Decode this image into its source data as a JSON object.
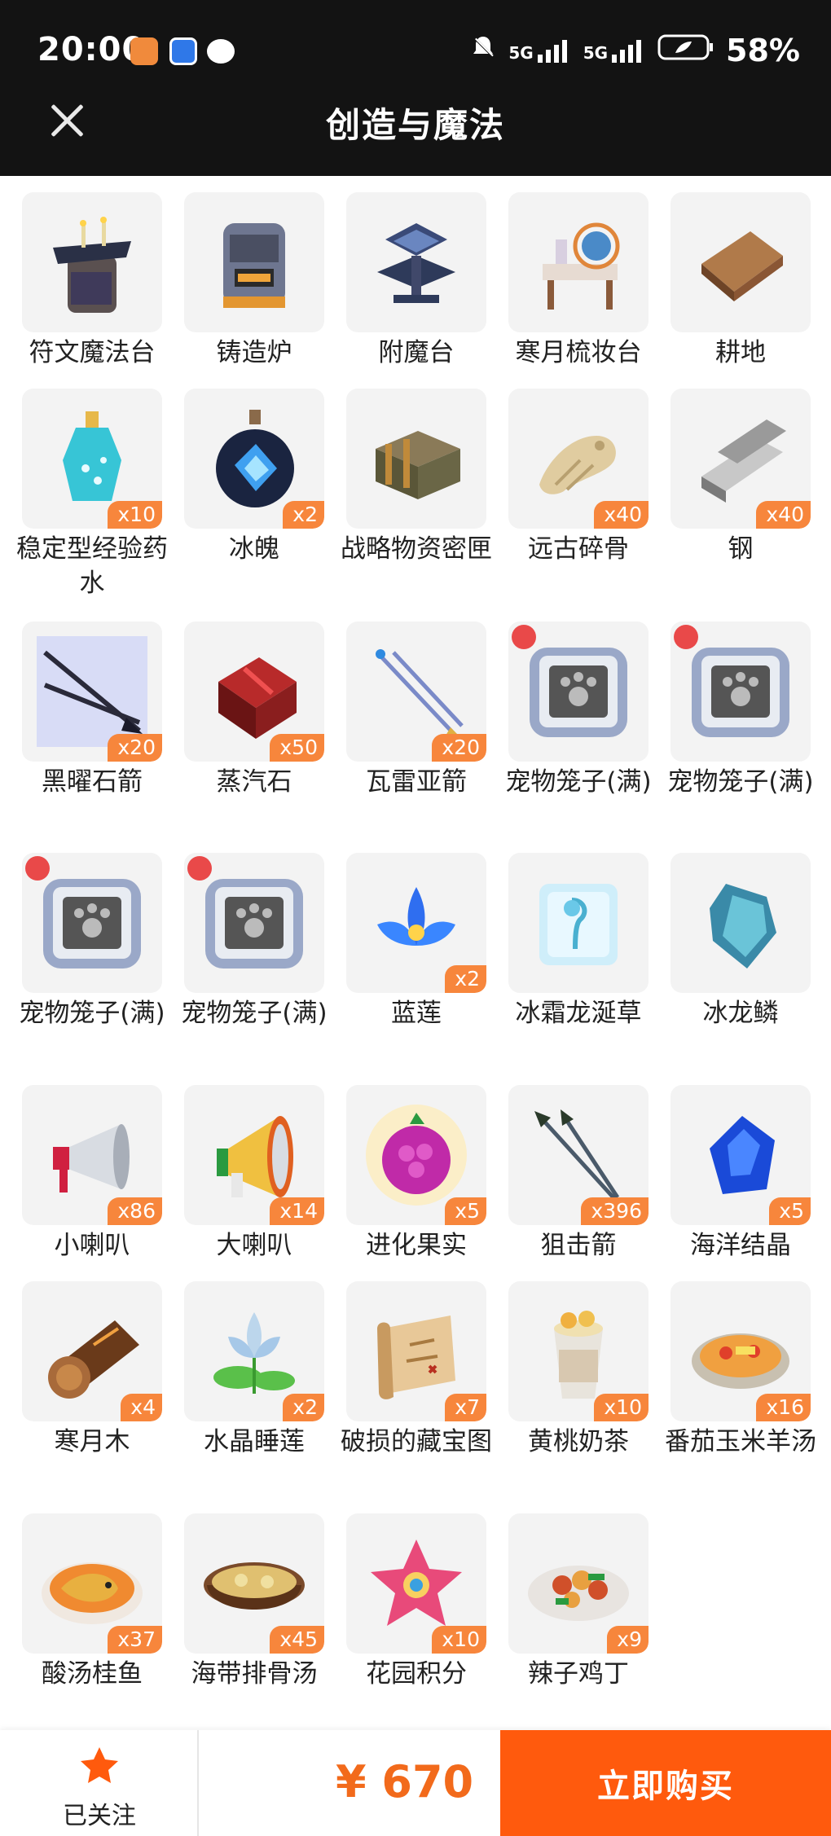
{
  "status_bar": {
    "time": "20:00",
    "network": "5G",
    "battery": "58%"
  },
  "header": {
    "title": "创造与魔法"
  },
  "items": [
    {
      "name": "符文魔法台",
      "qty": "",
      "icon": "rune-table-icon"
    },
    {
      "name": "铸造炉",
      "qty": "",
      "icon": "forge-icon"
    },
    {
      "name": "附魔台",
      "qty": "",
      "icon": "enchant-table-icon"
    },
    {
      "name": "寒月梳妆台",
      "qty": "",
      "icon": "dresser-icon"
    },
    {
      "name": "耕地",
      "qty": "",
      "icon": "farmland-icon"
    },
    {
      "name": "稳定型经验药水",
      "qty": "x10",
      "icon": "potion-icon"
    },
    {
      "name": "冰魄",
      "qty": "x2",
      "icon": "ice-soul-icon"
    },
    {
      "name": "战略物资密匣",
      "qty": "",
      "icon": "supply-crate-icon"
    },
    {
      "name": "远古碎骨",
      "qty": "x40",
      "icon": "bone-icon"
    },
    {
      "name": "钢",
      "qty": "x40",
      "icon": "steel-ingot-icon"
    },
    {
      "name": "黑曜石箭",
      "qty": "x20",
      "icon": "obsidian-arrow-icon"
    },
    {
      "name": "蒸汽石",
      "qty": "x50",
      "icon": "steam-stone-icon"
    },
    {
      "name": "瓦雷亚箭",
      "qty": "x20",
      "icon": "valyrian-arrow-icon"
    },
    {
      "name": "宠物笼子(满)",
      "qty": "",
      "icon": "pet-cage-icon"
    },
    {
      "name": "宠物笼子(满)",
      "qty": "",
      "icon": "pet-cage-icon"
    },
    {
      "name": "宠物笼子(满)",
      "qty": "",
      "icon": "pet-cage-icon"
    },
    {
      "name": "宠物笼子(满)",
      "qty": "",
      "icon": "pet-cage-icon"
    },
    {
      "name": "蓝莲",
      "qty": "x2",
      "icon": "blue-lotus-icon"
    },
    {
      "name": "冰霜龙涎草",
      "qty": "",
      "icon": "frost-herb-icon"
    },
    {
      "name": "冰龙鳞",
      "qty": "",
      "icon": "ice-dragon-scale-icon"
    },
    {
      "name": "小喇叭",
      "qty": "x86",
      "icon": "small-horn-icon"
    },
    {
      "name": "大喇叭",
      "qty": "x14",
      "icon": "big-horn-icon"
    },
    {
      "name": "进化果实",
      "qty": "x5",
      "icon": "evolution-fruit-icon"
    },
    {
      "name": "狙击箭",
      "qty": "x396",
      "icon": "sniper-arrow-icon"
    },
    {
      "name": "海洋结晶",
      "qty": "x5",
      "icon": "ocean-crystal-icon"
    },
    {
      "name": "寒月木",
      "qty": "x4",
      "icon": "log-icon"
    },
    {
      "name": "水晶睡莲",
      "qty": "x2",
      "icon": "crystal-lily-icon"
    },
    {
      "name": "破损的藏宝图",
      "qty": "x7",
      "icon": "treasure-map-icon"
    },
    {
      "name": "黄桃奶茶",
      "qty": "x10",
      "icon": "milk-tea-icon"
    },
    {
      "name": "番茄玉米羊汤",
      "qty": "x16",
      "icon": "mutton-soup-icon"
    },
    {
      "name": "酸汤桂鱼",
      "qty": "x37",
      "icon": "fish-soup-icon"
    },
    {
      "name": "海带排骨汤",
      "qty": "x45",
      "icon": "kelp-soup-icon"
    },
    {
      "name": "花园积分",
      "qty": "x10",
      "icon": "garden-point-icon"
    },
    {
      "name": "辣子鸡丁",
      "qty": "x9",
      "icon": "spicy-chicken-icon"
    }
  ],
  "bottom_bar": {
    "follow_label": "已关注",
    "price": "¥ 670",
    "buy_label": "立即购买"
  },
  "colors": {
    "accent": "#ff5a0d",
    "price": "#f26a1b",
    "badge": "#f7863c",
    "header_bg": "#131313"
  }
}
